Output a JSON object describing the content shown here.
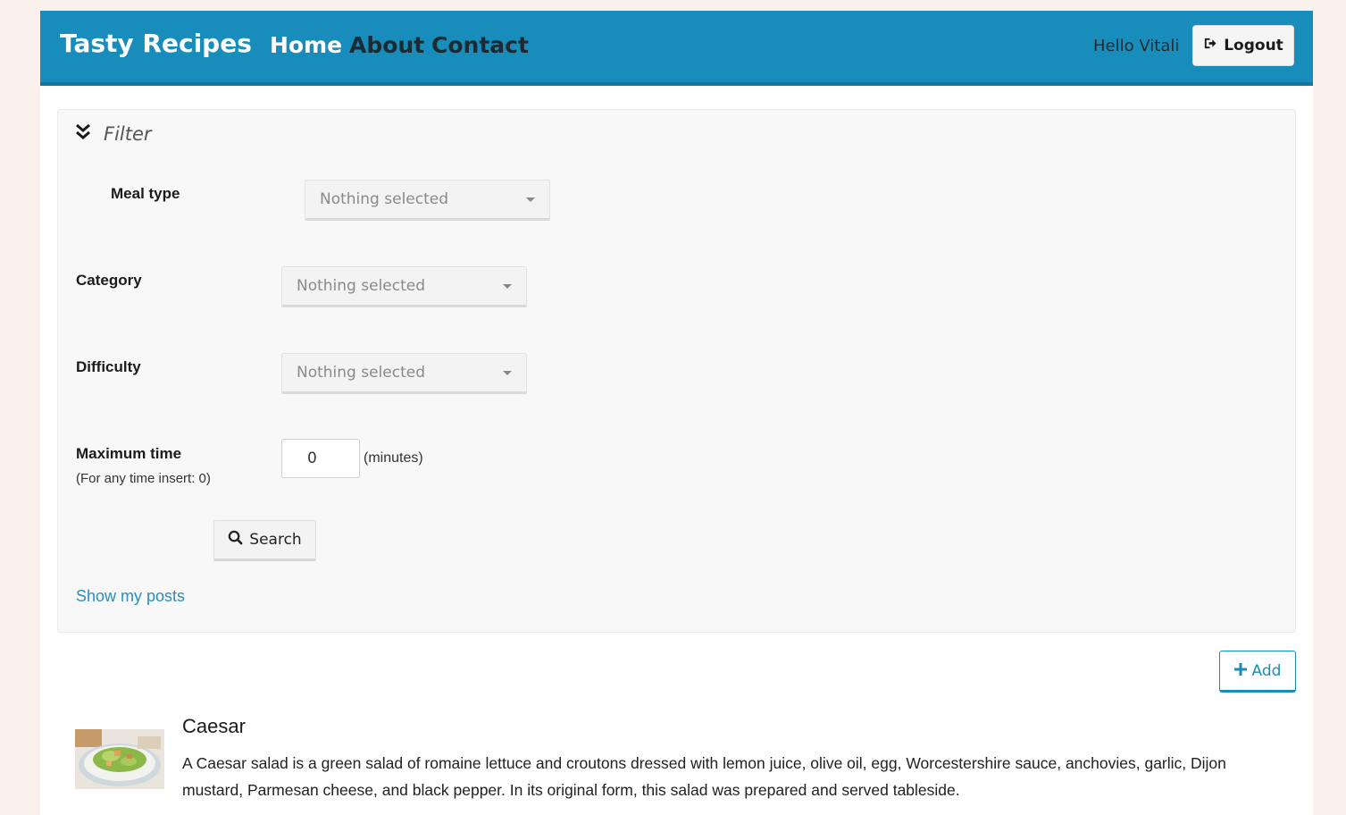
{
  "navbar": {
    "brand": "Tasty Recipes",
    "links": [
      {
        "label": "Home"
      },
      {
        "label": "About"
      },
      {
        "label": "Contact"
      }
    ],
    "greeting": "Hello Vitali",
    "logout_label": "Logout",
    "color": "#188dbb"
  },
  "filter": {
    "title": "Filter",
    "meal_type": {
      "label": "Meal type",
      "value": "Nothing selected"
    },
    "category": {
      "label": "Category",
      "value": "Nothing selected"
    },
    "difficulty": {
      "label": "Difficulty",
      "value": "Nothing selected"
    },
    "max_time": {
      "label": "Maximum time",
      "hint": "(For any time insert: 0)",
      "value": "0",
      "unit": "(minutes)"
    },
    "search_label": "Search",
    "show_posts_label": "Show my posts"
  },
  "actions": {
    "add_label": "Add"
  },
  "recipes": [
    {
      "title": "Caesar",
      "description": "A Caesar salad is a green salad of romaine lettuce and croutons dressed with lemon juice, olive oil, egg, Worcestershire sauce, anchovies, garlic, Dijon mustard, Parmesan cheese, and black pepper. In its original form, this salad was prepared and served tableside."
    }
  ]
}
